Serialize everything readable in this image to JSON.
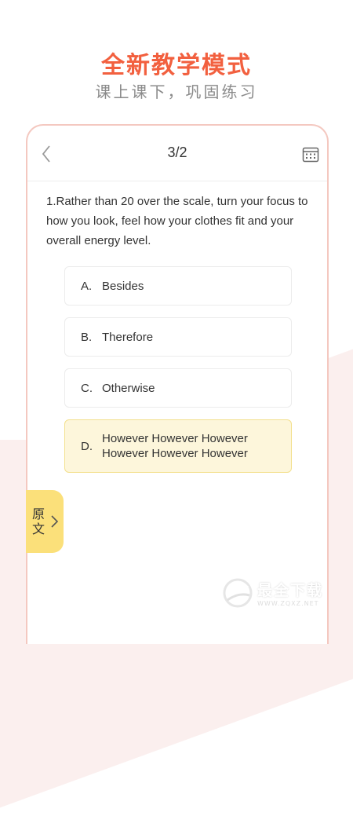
{
  "header": {
    "title": "全新教学模式",
    "subtitle": "课上课下，巩固练习"
  },
  "quiz": {
    "page_indicator": "3/2",
    "question": "1.Rather than 20 over the scale, turn your focus to how you look, feel how your clothes fit and your overall energy level.",
    "options": [
      {
        "letter": "A.",
        "text": "Besides",
        "selected": false
      },
      {
        "letter": "B.",
        "text": "Therefore",
        "selected": false
      },
      {
        "letter": "C.",
        "text": "Otherwise",
        "selected": false
      },
      {
        "letter": "D.",
        "text": "However  However  However However  However  However",
        "selected": true
      }
    ],
    "original_tab_label": "原文"
  },
  "icons": {
    "back": "chevron-left-icon",
    "grid": "answer-sheet-grid-icon",
    "tab_arrow": "chevron-right-icon"
  },
  "watermark": {
    "main": "最全下载",
    "sub": "WWW.ZQXZ.NET"
  },
  "colors": {
    "accent": "#f2603f",
    "subtitle": "#8a8a8a",
    "selected_bg": "#fdf6db",
    "selected_border": "#f3e08e",
    "tab_bg": "#fbe07a",
    "frame_border": "#f4c8c0",
    "bg_shape": "#fbefee"
  }
}
